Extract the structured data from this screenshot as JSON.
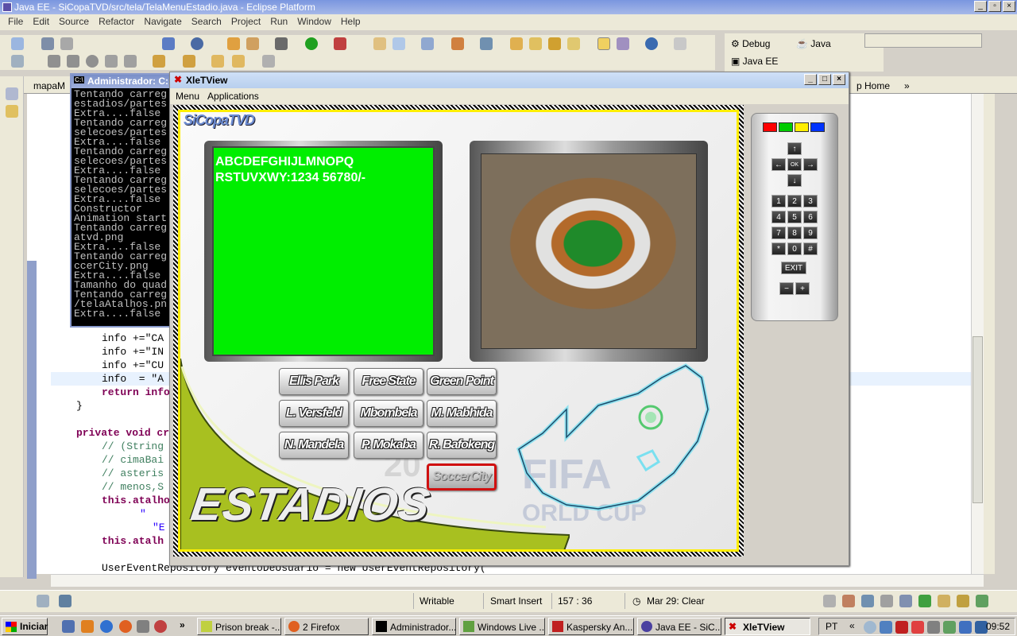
{
  "eclipse": {
    "title": "Java EE - SiCopaTVD/src/tela/TelaMenuEstadio.java - Eclipse Platform",
    "menu": [
      "File",
      "Edit",
      "Source",
      "Refactor",
      "Navigate",
      "Search",
      "Project",
      "Run",
      "Window",
      "Help"
    ],
    "perspectives": {
      "debug": "Debug",
      "java": "Java",
      "javaee": "Java EE"
    },
    "tabs": {
      "left": "mapaM",
      "right": "p Home"
    },
    "code": {
      "l1": "info +=\"CA",
      "l2": "info +=\"IN",
      "l3": "info +=\"CU",
      "l4": "info  = \"A",
      "l5": "return info",
      "l6": "}",
      "l7": "private void cr",
      "l8": "// (String",
      "l9": "// cimaBai",
      "l10": "// asteris",
      "l11": "// menos,S",
      "l12": "this.atalho",
      "l13": "\"",
      "l14": "\"E",
      "l15": "this.atalh",
      "l16": "UserEventRepository eventoDeUsuario = new UserEventRepository("
    },
    "status": {
      "writable": "Writable",
      "insert": "Smart Insert",
      "position": "157 : 36",
      "date": "Mar 29: Clear"
    }
  },
  "console": {
    "title": "Administrador: C:",
    "lines": [
      "Tentando carreg",
      "estadios/partes",
      "Extra....false",
      "Tentando carreg",
      "selecoes/partes",
      "Extra....false",
      "Tentando carreg",
      "selecoes/partes",
      "Extra....false",
      "Tentando carreg",
      "selecoes/partes",
      "Extra....false",
      "Constructor",
      "Animation start",
      "Tentando carreg",
      "atvd.png",
      "Extra....false",
      "Tentando carreg",
      "ccerCity.png",
      "Extra....false",
      "Tamanho do quad",
      "Tentando carreg",
      "/telaAtalhos.pn",
      "Extra....false"
    ]
  },
  "xlet": {
    "title": "XleTView",
    "menu": [
      "Menu",
      "Applications"
    ],
    "logo": "SiCopaTVD",
    "green_text": "ABCDEFGHIJLMNOPQ\nRSTUVXWY:1234 56780/-",
    "section_title": "ESTADIOS",
    "bg_text": {
      "fifa": "FIFA",
      "worldcup": "ORLD CUP",
      "year": "20"
    },
    "stadiums": [
      "Ellis Park",
      "Free State",
      "Green Point",
      "L. Versfeld",
      "Mbombela",
      "M. Mabhida",
      "N. Mandela",
      "P. Mokaba",
      "R. Bafokeng",
      "SoccerCity"
    ],
    "selected": "SoccerCity"
  },
  "remote": {
    "colors": [
      "#ff0000",
      "#00cc00",
      "#ffee00",
      "#0033ff"
    ],
    "arrows": {
      "up": "↑",
      "left": "←",
      "ok": "OK",
      "right": "→",
      "down": "↓"
    },
    "keys": [
      "1",
      "2",
      "3",
      "4",
      "5",
      "6",
      "7",
      "8",
      "9",
      "*",
      "0",
      "#"
    ],
    "exit": "EXIT",
    "minus": "−",
    "plus": "+"
  },
  "taskbar": {
    "start": "Iniciar",
    "tasks": [
      "Prison break -...",
      "2 Firefox",
      "Administrador...",
      "Windows Live ...",
      "Kaspersky An...",
      "Java EE - SiC...",
      "XleTView"
    ],
    "lang": "PT",
    "clock": "09:52"
  }
}
